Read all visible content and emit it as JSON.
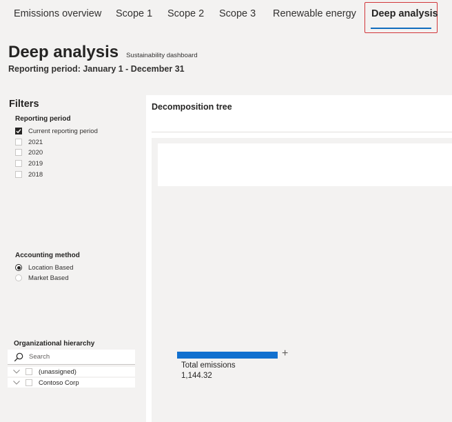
{
  "tabs": [
    {
      "label": "Emissions overview"
    },
    {
      "label": "Scope 1"
    },
    {
      "label": "Scope 2"
    },
    {
      "label": "Scope 3"
    },
    {
      "label": "Renewable energy"
    },
    {
      "label": "Deep analysis",
      "active": true
    }
  ],
  "header": {
    "title": "Deep analysis",
    "subtitle": "Sustainability dashboard",
    "reporting_period": "Reporting period: January 1 - December 31"
  },
  "filters": {
    "title": "Filters",
    "reporting_period": {
      "label": "Reporting period",
      "options": [
        {
          "label": "Current reporting period",
          "checked": true
        },
        {
          "label": "2021",
          "checked": false
        },
        {
          "label": "2020",
          "checked": false
        },
        {
          "label": "2019",
          "checked": false
        },
        {
          "label": "2018",
          "checked": false
        }
      ]
    },
    "accounting_method": {
      "label": "Accounting method",
      "options": [
        {
          "label": "Location Based",
          "selected": true
        },
        {
          "label": "Market Based",
          "selected": false
        }
      ]
    },
    "org_hierarchy": {
      "label": "Organizational hierarchy",
      "search_placeholder": "Search",
      "items": [
        {
          "label": "(unassigned)"
        },
        {
          "label": "Contoso Corp"
        }
      ]
    }
  },
  "visual": {
    "title": "Decomposition tree",
    "node": {
      "label": "Total emissions",
      "value": "1,144.32",
      "expand_symbol": "+"
    }
  },
  "colors": {
    "accent": "#0f6cbd",
    "bar": "#1170cf",
    "highlight_border": "#d13438"
  }
}
